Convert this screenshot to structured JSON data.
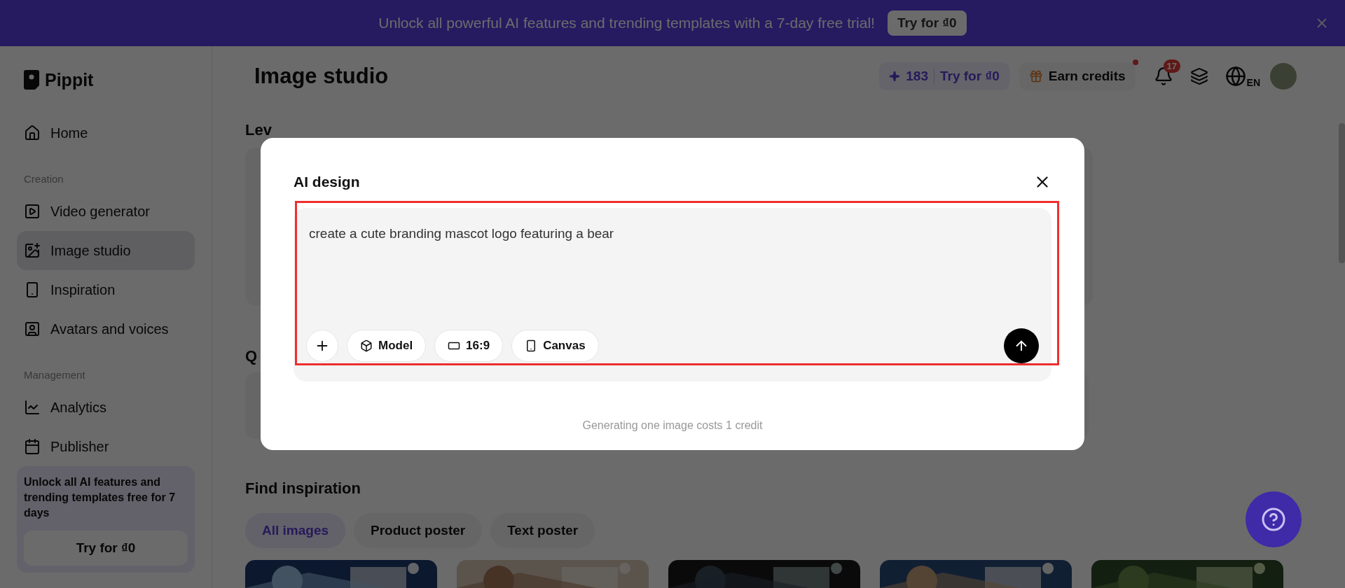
{
  "banner": {
    "text": "Unlock all powerful AI features and trending templates with a 7-day free trial!",
    "button": "Try for ₫0"
  },
  "sidebar": {
    "logo": "Pippit",
    "sections": [
      {
        "items": [
          {
            "label": "Home",
            "selected": false
          }
        ]
      },
      {
        "label": "Creation",
        "items": [
          {
            "label": "Video generator",
            "selected": false
          },
          {
            "label": "Image studio",
            "selected": true
          },
          {
            "label": "Inspiration",
            "selected": false
          },
          {
            "label": "Avatars and voices",
            "selected": false
          }
        ]
      },
      {
        "label": "Management",
        "items": [
          {
            "label": "Analytics",
            "selected": false
          },
          {
            "label": "Publisher",
            "selected": false
          }
        ]
      }
    ],
    "promo": {
      "text": "Unlock all AI features and trending templates free for 7 days",
      "button": "Try for ₫0"
    }
  },
  "header": {
    "title": "Image studio",
    "credits": "183",
    "credits_button": "Try for ₫0",
    "earn_credits": "Earn credits",
    "notifications": "17",
    "language": "EN"
  },
  "content": {
    "headings": [
      "Lev",
      "Q",
      "Find inspiration"
    ],
    "filters": [
      {
        "label": "All images",
        "selected": true
      },
      {
        "label": "Product poster",
        "selected": false
      },
      {
        "label": "Text poster",
        "selected": false
      }
    ]
  },
  "modal": {
    "title": "AI design",
    "prompt": "create a cute branding mascot logo featuring a bear",
    "highlighted": true,
    "tools": [
      {
        "kind": "add"
      },
      {
        "kind": "model",
        "label": "Model"
      },
      {
        "kind": "ratio",
        "label": "16:9"
      },
      {
        "kind": "canvas",
        "label": "Canvas"
      }
    ],
    "note": "Generating one image costs 1 credit"
  }
}
